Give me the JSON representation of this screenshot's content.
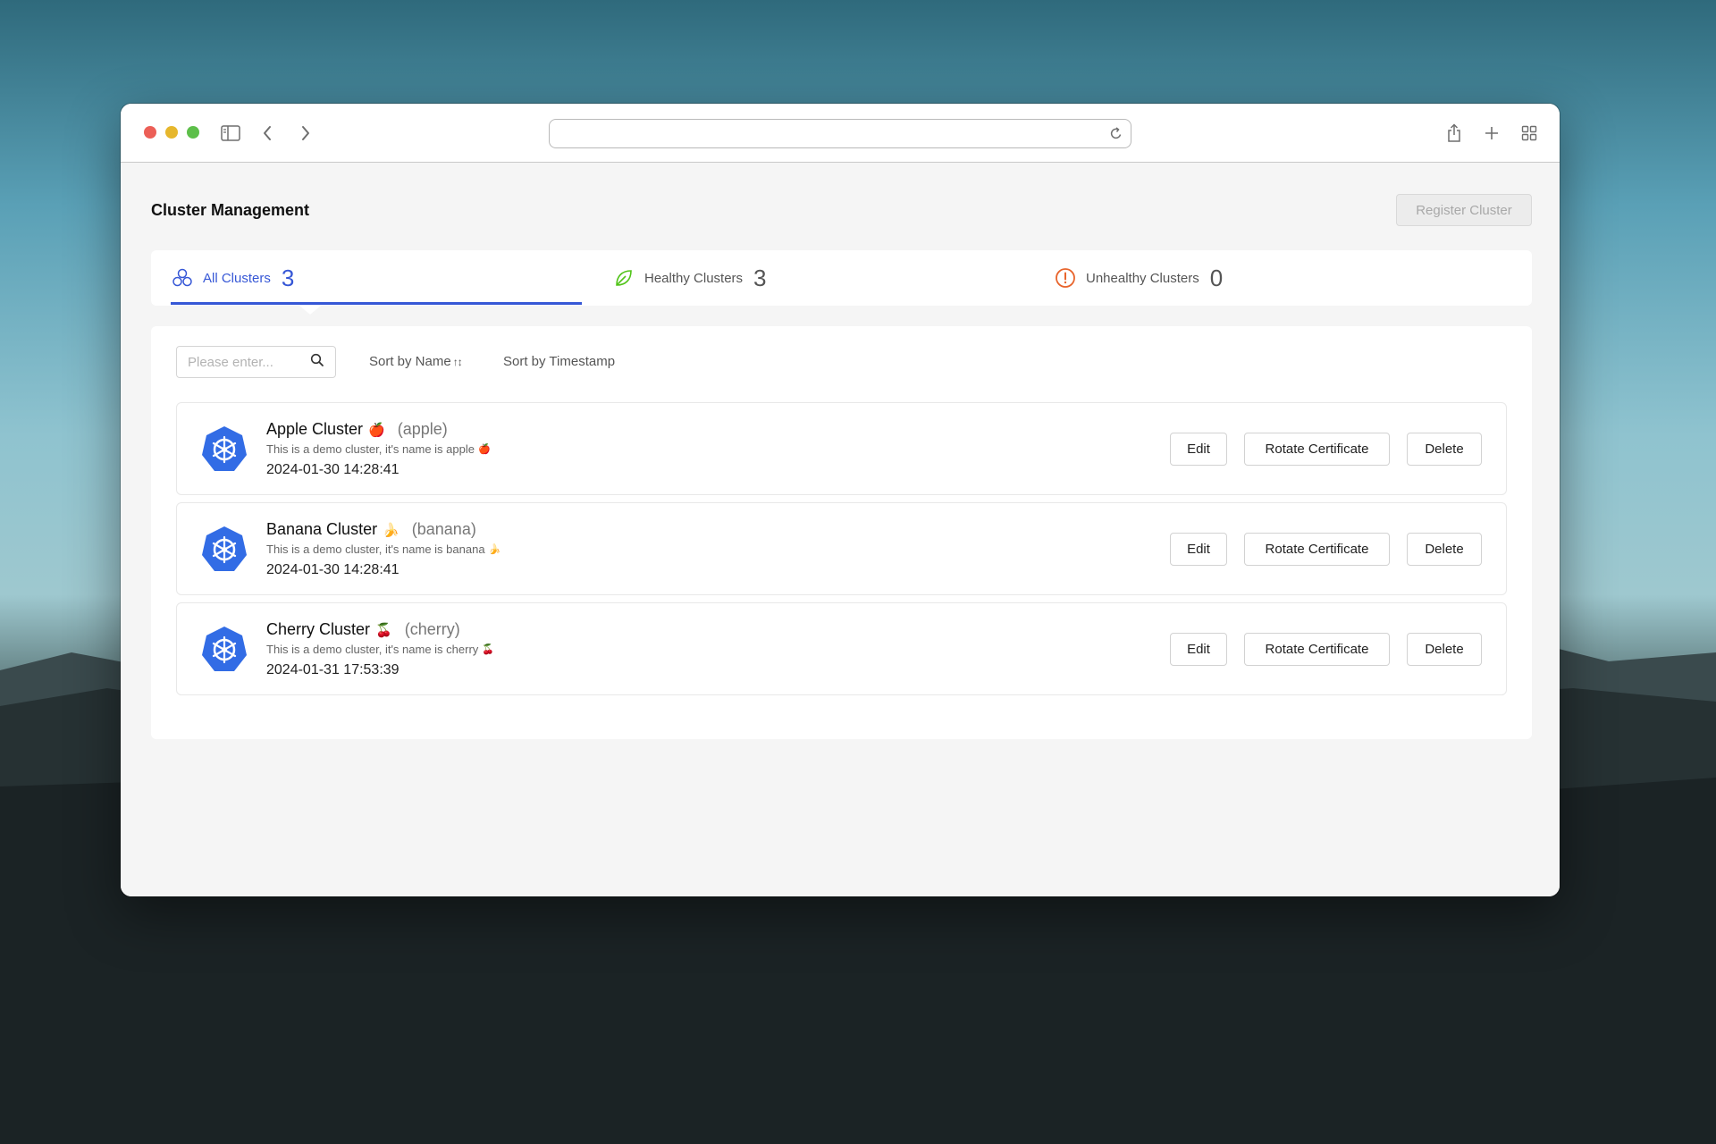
{
  "browser": {
    "url": ""
  },
  "page": {
    "title": "Cluster Management",
    "register_label": "Register Cluster"
  },
  "tabs": [
    {
      "label": "All Clusters",
      "count": "3",
      "icon": "clusters-icon",
      "active": true
    },
    {
      "label": "Healthy Clusters",
      "count": "3",
      "icon": "leaf-icon",
      "active": false
    },
    {
      "label": "Unhealthy Clusters",
      "count": "0",
      "icon": "alert-icon",
      "active": false
    }
  ],
  "toolbar": {
    "search_placeholder": "Please enter...",
    "sort_by_name": "Sort by Name",
    "sort_by_timestamp": "Sort by Timestamp"
  },
  "clusters": [
    {
      "name": "Apple Cluster",
      "emoji": "🍎",
      "id": "(apple)",
      "description": "This is a demo cluster, it's name is apple",
      "timestamp": "2024-01-30 14:28:41"
    },
    {
      "name": "Banana Cluster",
      "emoji": "🍌",
      "id": "(banana)",
      "description": "This is a demo cluster, it's name is banana",
      "timestamp": "2024-01-30 14:28:41"
    },
    {
      "name": "Cherry Cluster",
      "emoji": "🍒",
      "id": "(cherry)",
      "description": "This is a demo cluster, it's name is cherry",
      "timestamp": "2024-01-31 17:53:39"
    }
  ],
  "actions": {
    "edit": "Edit",
    "rotate": "Rotate Certificate",
    "delete": "Delete"
  },
  "colors": {
    "accent": "#3657d6",
    "healthy": "#52c41a",
    "unhealthy": "#e8642c",
    "kubernetes": "#326ce5"
  }
}
